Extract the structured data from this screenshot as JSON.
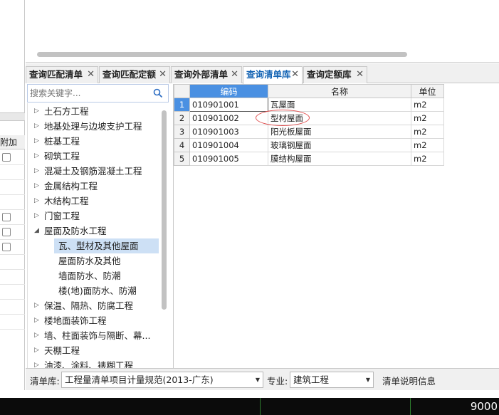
{
  "left_panel": {
    "column_header": "附加"
  },
  "tabs": [
    {
      "label": "查询匹配清单",
      "active": false
    },
    {
      "label": "查询匹配定额",
      "active": false
    },
    {
      "label": "查询外部清单",
      "active": false
    },
    {
      "label": "查询清单库",
      "active": true
    },
    {
      "label": "查询定额库",
      "active": false
    }
  ],
  "search": {
    "placeholder": "搜索关键字..."
  },
  "tree": [
    {
      "label": "土石方工程",
      "expanded": false
    },
    {
      "label": "地基处理与边坡支护工程",
      "expanded": false
    },
    {
      "label": "桩基工程",
      "expanded": false
    },
    {
      "label": "砌筑工程",
      "expanded": false
    },
    {
      "label": "混凝土及钢筋混凝土工程",
      "expanded": false
    },
    {
      "label": "金属结构工程",
      "expanded": false
    },
    {
      "label": "木结构工程",
      "expanded": false
    },
    {
      "label": "门窗工程",
      "expanded": false
    },
    {
      "label": "屋面及防水工程",
      "expanded": true
    },
    {
      "label": "瓦、型材及其他屋面",
      "child": true,
      "selected": true
    },
    {
      "label": "屋面防水及其他",
      "child": true
    },
    {
      "label": "墙面防水、防潮",
      "child": true
    },
    {
      "label": "楼(地)面防水、防潮",
      "child": true
    },
    {
      "label": "保温、隔热、防腐工程",
      "expanded": false
    },
    {
      "label": "楼地面装饰工程",
      "expanded": false
    },
    {
      "label": "墙、柱面装饰与隔断、幕...",
      "expanded": false
    },
    {
      "label": "天棚工程",
      "expanded": false
    },
    {
      "label": "油漆、涂料、裱糊工程",
      "expanded": false
    }
  ],
  "table": {
    "headers": {
      "code": "编码",
      "name": "名称",
      "unit": "单位"
    },
    "rows": [
      {
        "num": "1",
        "code": "010901001",
        "name": "瓦屋面",
        "unit": "m2"
      },
      {
        "num": "2",
        "code": "010901002",
        "name": "型材屋面",
        "unit": "m2"
      },
      {
        "num": "3",
        "code": "010901003",
        "name": "阳光板屋面",
        "unit": "m2"
      },
      {
        "num": "4",
        "code": "010901004",
        "name": "玻璃钢屋面",
        "unit": "m2"
      },
      {
        "num": "5",
        "code": "010901005",
        "name": "膜结构屋面",
        "unit": "m2"
      }
    ]
  },
  "bottom": {
    "library_label": "清单库:",
    "library_value": "工程量清单项目计量规范(2013-广东)",
    "specialty_label": "专业:",
    "specialty_value": "建筑工程",
    "info_label": "清单说明信息"
  },
  "status": {
    "value": "9000"
  },
  "colors": {
    "accent": "#4a90e2",
    "active_tab_text": "#1464b4",
    "selection": "#cde0f5",
    "annotation": "#e05050"
  }
}
